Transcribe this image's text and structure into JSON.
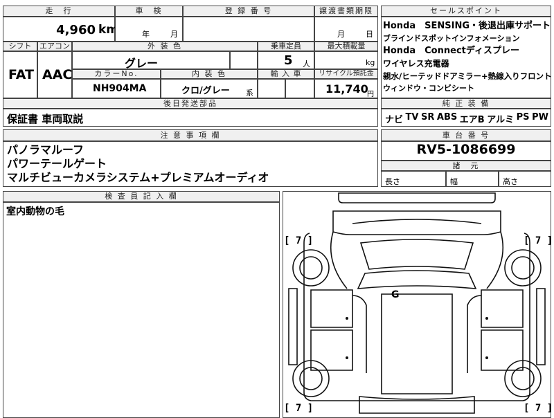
{
  "headers": {
    "mileage": "走　行",
    "inspection": "車　検",
    "registration": "登 録 番 号",
    "transfer_deadline": "譲渡書類期限",
    "sales_point": "セールスポイント",
    "shift": "シフト",
    "aircon": "エアコン",
    "exterior_color": "外 装 色",
    "capacity": "乗車定員",
    "max_load": "最大積載量",
    "color_no": "カラーNo.",
    "interior_color": "内 装 色",
    "import": "輸 入 車",
    "recycle": "リサイクル預託金",
    "later_parts": "後日発送部品",
    "genuine_equipment": "純 正 装 備",
    "notes": "注 意 事 項 欄",
    "chassis_no": "車 台 番 号",
    "dimensions": "諸　元",
    "inspector": "検 査 員 記 入 欄"
  },
  "mileage": {
    "value": "4,960",
    "unit": "km"
  },
  "inspection": {
    "year_unit": "年",
    "month_unit": "月"
  },
  "transfer": {
    "month_unit": "月",
    "day_unit": "日"
  },
  "sales_points": [
    "Honda　SENSING・後退出庫サポート",
    "ブラインドスポットインフォメーション",
    "Honda　Connectディスプレー",
    "ワイヤレス充電器",
    "親水/ヒーテッドドアミラー+熱線入りフロント",
    "ウィンドウ・コンビシート"
  ],
  "shift": "FAT",
  "aircon": "AAC",
  "exterior_color": "グレー",
  "capacity": {
    "value": "5",
    "unit": "人"
  },
  "max_load": {
    "unit": "kg"
  },
  "color_no": "NH904MA",
  "interior_color": {
    "value": "クロ/グレー",
    "suffix": "系"
  },
  "recycle": {
    "value": "11,740",
    "unit": "円"
  },
  "later_parts": "保証書 車両取説",
  "genuine_equipment": [
    "ナビ",
    "TV",
    "SR",
    "ABS",
    "エアB",
    "アルミ",
    "PS",
    "PW"
  ],
  "notes": [
    "パノラマルーフ",
    "パワーテールゲート",
    "マルチビューカメラシステム+プレミアムオーディオ"
  ],
  "chassis_no": "RV5-1086699",
  "dimensions": {
    "length": "長さ",
    "width": "幅",
    "height": "高さ"
  },
  "inspector_note": "室内動物の毛",
  "diagram_marks": {
    "tl": "[ 7 ]",
    "tr": "[ 7 ]",
    "bl": "[ 7 ]",
    "br": "[ 7 ]",
    "center": "G"
  }
}
